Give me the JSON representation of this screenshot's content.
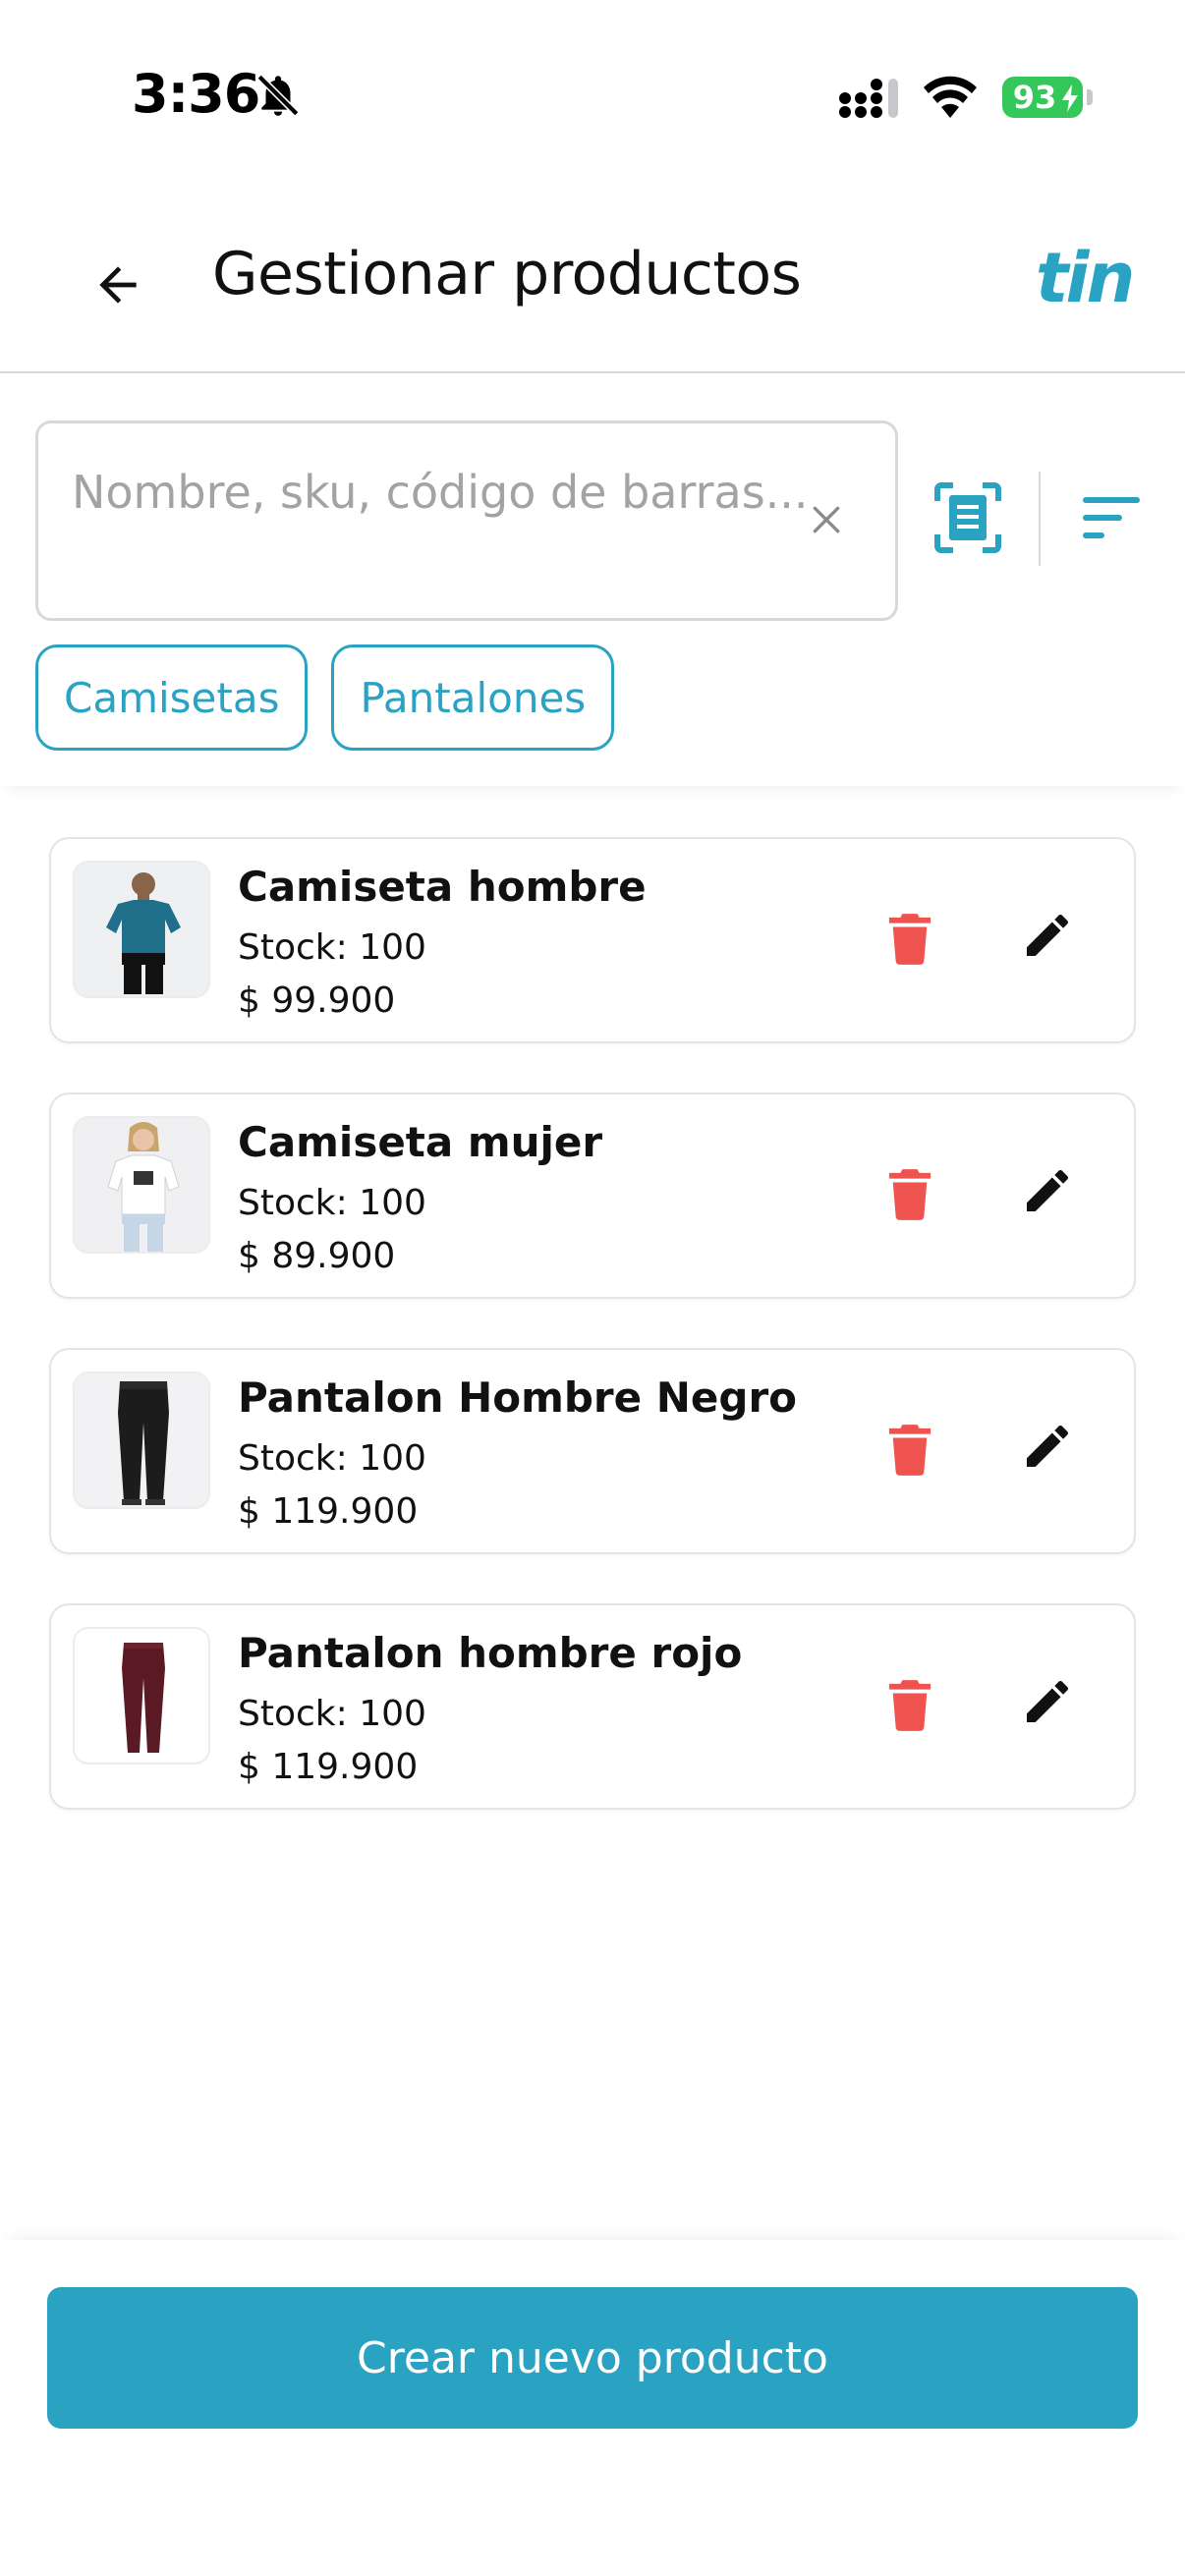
{
  "status_bar": {
    "time": "3:36",
    "battery": "93"
  },
  "header": {
    "title": "Gestionar productos",
    "brand": "tin"
  },
  "search": {
    "placeholder": "Nombre, sku, código de barras..."
  },
  "chips": [
    {
      "label": "Camisetas"
    },
    {
      "label": "Pantalones"
    }
  ],
  "products": [
    {
      "name": "Camiseta hombre",
      "stock": "Stock: 100",
      "price": "$ 99.900",
      "thumb": "blue-tshirt-man"
    },
    {
      "name": "Camiseta mujer",
      "stock": "Stock: 100",
      "price": "$ 89.900",
      "thumb": "white-tshirt-woman"
    },
    {
      "name": "Pantalon Hombre Negro",
      "stock": "Stock: 100",
      "price": "$ 119.900",
      "thumb": "black-pants"
    },
    {
      "name": "Pantalon hombre rojo",
      "stock": "Stock: 100",
      "price": "$ 119.900",
      "thumb": "red-pants"
    }
  ],
  "actions": {
    "create_label": "Crear nuevo producto"
  },
  "colors": {
    "accent": "#2aa3c2",
    "delete": "#ef5350",
    "battery": "#34c759"
  },
  "icons": {
    "back": "arrow-left-icon",
    "clear": "close-icon",
    "scan": "barcode-scan-icon",
    "sort": "sort-icon",
    "delete": "trash-icon",
    "edit": "pencil-icon"
  }
}
